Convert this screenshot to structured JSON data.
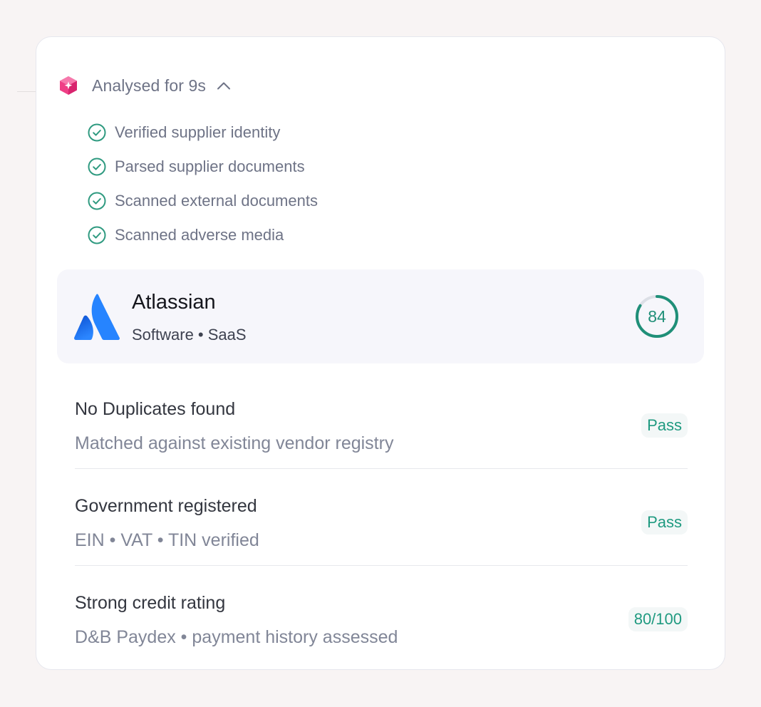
{
  "analysis": {
    "label": "Analysed for 9s",
    "icon": "gem-sparkle-icon",
    "toggle_icon": "chevron-up-icon",
    "steps": [
      {
        "label": "Verified supplier identity",
        "status": "done"
      },
      {
        "label": "Parsed supplier documents",
        "status": "done"
      },
      {
        "label": "Scanned external documents",
        "status": "done"
      },
      {
        "label": "Scanned adverse media",
        "status": "done"
      }
    ]
  },
  "vendor": {
    "name": "Atlassian",
    "category": "Software • SaaS",
    "logo": "atlassian-logo",
    "score": "84",
    "score_fraction": 0.84
  },
  "checks": [
    {
      "title": "No Duplicates found",
      "subtitle": "Matched against existing vendor registry",
      "badge": "Pass"
    },
    {
      "title": "Government registered",
      "subtitle": "EIN • VAT • TIN verified",
      "badge": "Pass"
    },
    {
      "title": "Strong credit rating",
      "subtitle": "D&B Paydex • payment history assessed",
      "badge": "80/100"
    }
  ],
  "colors": {
    "accent_green": "#1f8f78",
    "check_green": "#2f9a80",
    "brand_blue": "#1f6fe6",
    "gem_pink": "#ef3f86"
  }
}
